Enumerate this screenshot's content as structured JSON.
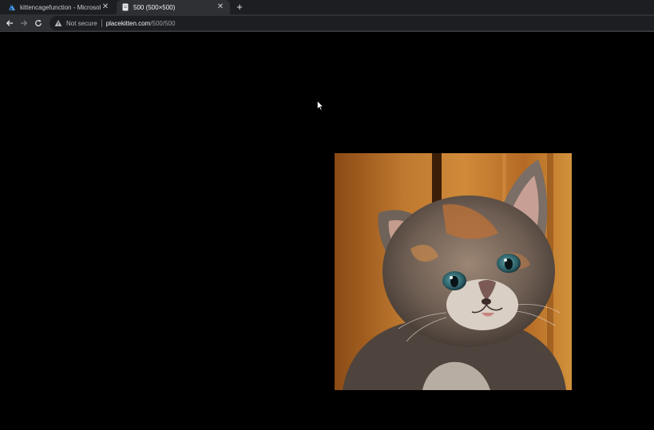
{
  "tabs": [
    {
      "title": "kittencagefunction - Microsoft A",
      "favicon": "azure-icon",
      "active": false
    },
    {
      "title": "500 (500×500)",
      "favicon": "page-icon",
      "active": true
    }
  ],
  "toolbar": {
    "security_label": "Not secure",
    "url_host": "placekitten.com",
    "url_path": "/500/500"
  },
  "content": {
    "image_subject": "kitten-photo",
    "image_size_label": "500×500"
  },
  "colors": {
    "tabstrip": "#1d1e22",
    "toolbar": "#2f3034",
    "omnibox": "#1d1e22",
    "page_background": "#000000",
    "azure_blue": "#2b7bd8"
  }
}
